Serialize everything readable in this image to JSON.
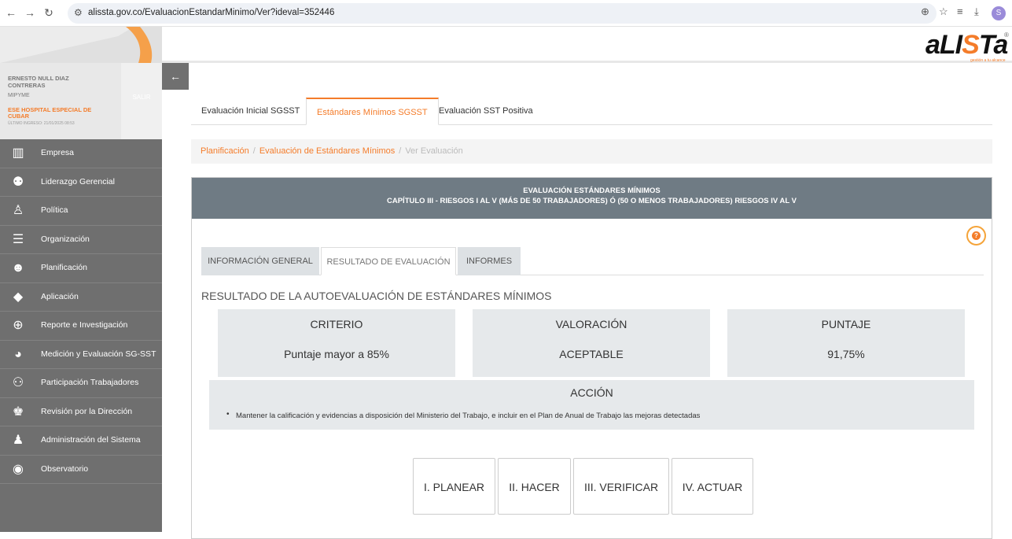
{
  "browser": {
    "url": "alissta.gov.co/EvaluacionEstandarMinimo/Ver?ideval=352446",
    "profile_initial": "S"
  },
  "user": {
    "name": "ERNESTO NULL DIAZ CONTRERAS",
    "type": "MIPYME",
    "company": "ESE HOSPITAL ESPECIAL DE CUBAR",
    "last_login": "ÚLTIMO INGRESO: 21/01/2025 08:53",
    "logout": "SALIR"
  },
  "logo": {
    "text_a": "aLI",
    "text_s": "S",
    "text_b": "Ta",
    "tagline": "gestión a tu alcance"
  },
  "sidebar": {
    "items": [
      {
        "label": "Empresa",
        "icon": "building-icon"
      },
      {
        "label": "Liderazgo Gerencial",
        "icon": "team-icon"
      },
      {
        "label": "Política",
        "icon": "podium-icon"
      },
      {
        "label": "Organización",
        "icon": "list-icon"
      },
      {
        "label": "Planificación",
        "icon": "head-icon"
      },
      {
        "label": "Aplicación",
        "icon": "tag-icon"
      },
      {
        "label": "Reporte e Investigación",
        "icon": "magnifier-icon"
      },
      {
        "label": "Medición y Evaluación SG-SST",
        "icon": "pie-chart-icon"
      },
      {
        "label": "Participación Trabajadores",
        "icon": "people-icon"
      },
      {
        "label": "Revisión por la Dirección",
        "icon": "manager-icon"
      },
      {
        "label": "Administración del Sistema",
        "icon": "user-settings-icon"
      },
      {
        "label": "Observatorio",
        "icon": "globe-icon"
      }
    ]
  },
  "tabs": [
    "Evaluación Inicial SGSST",
    "Estándares Mínimos SGSST",
    "Evaluación SST Positiva"
  ],
  "breadcrumb": {
    "items": [
      "Planificación",
      "Evaluación de Estándares Mínimos"
    ],
    "current": "Ver Evaluación"
  },
  "panel": {
    "title": "EVALUACIÓN ESTÁNDARES MÍNIMOS",
    "subtitle": "CAPÍTULO III - RIESGOS I AL V (MÁS DE 50 TRABAJADORES) Ó (50 O MENOS TRABAJADORES) RIESGOS IV AL V"
  },
  "subtabs": [
    "INFORMACIÓN GENERAL",
    "RESULTADO DE EVALUACIÓN",
    "INFORMES"
  ],
  "result": {
    "section_title": "RESULTADO DE LA AUTOEVALUACIÓN DE ESTÁNDARES MÍNIMOS",
    "criterio_label": "CRITERIO",
    "criterio_value": "Puntaje mayor a 85%",
    "valoracion_label": "VALORACIÓN",
    "valoracion_value": "ACEPTABLE",
    "puntaje_label": "PUNTAJE",
    "puntaje_value": "91,75%",
    "accion_title": "ACCIÓN",
    "accion_text": "Mantener la calificación y evidencias a disposición del Ministerio del Trabajo, e incluir en el Plan de Anual de Trabajo las mejoras detectadas"
  },
  "phases": [
    "I. PLANEAR",
    "II. HACER",
    "III. VERIFICAR",
    "IV. ACTUAR"
  ],
  "colors": {
    "accent": "#f47c2a",
    "sidebar": "#6f6f6f",
    "panel_header": "#6f7b84"
  }
}
